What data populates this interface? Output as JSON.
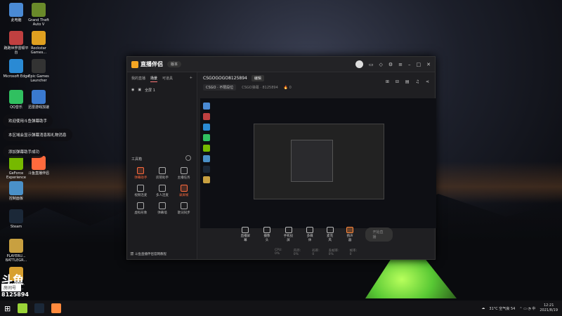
{
  "desktop": {
    "icons": [
      {
        "label": "此电脑",
        "color": "#4a8ad4"
      },
      {
        "label": "Grand Theft Auto V",
        "color": "#6a8a2a"
      },
      {
        "label": "跑跑世界雷顿平台",
        "color": "#c04040"
      },
      {
        "label": "Rockstar Games...",
        "color": "#e0a020"
      },
      {
        "label": "Microsoft Edge",
        "color": "#2a8ad4"
      },
      {
        "label": "Epic Games Launcher",
        "color": "#333333"
      },
      {
        "label": "QQ音乐",
        "color": "#30c060"
      },
      {
        "label": "迅雷游戏加速",
        "color": "#3a7ad0"
      },
      {
        "label": "GeForce Experience",
        "color": "#76b900"
      },
      {
        "label": "斗鱼直播伴侣",
        "color": "#ff6a3d"
      },
      {
        "label": "控制面板",
        "color": "#4a90c8"
      },
      {
        "label": "Steam",
        "color": "#1b2838"
      },
      {
        "label": "PLAYERU... BATTLEGR...",
        "color": "#c8a040"
      },
      {
        "label": "Counter... Global...",
        "color": "#d8a030"
      }
    ]
  },
  "notifications": [
    "欢迎使用斗鱼弹幕助手",
    "本区域会显示弹幕消息和礼物消息",
    "添加弹幕助手成功"
  ],
  "window": {
    "logo": "直播伴侣",
    "version_btn": "版本",
    "tabs": [
      "我的直播",
      "场景",
      "可道具"
    ],
    "scene_label": "全屏 1",
    "tools_header": "工具箱",
    "tools": [
      {
        "label": "弹幕助手",
        "active": true
      },
      {
        "label": "房管助手",
        "active": false
      },
      {
        "label": "主播任务",
        "active": false
      },
      {
        "label": "视频连麦",
        "active": false
      },
      {
        "label": "多人连麦",
        "active": false
      },
      {
        "label": "录屏帧",
        "active": true
      },
      {
        "label": "虚拟形象",
        "active": false
      },
      {
        "label": "弹幕墙",
        "active": false
      },
      {
        "label": "歌词同步",
        "active": false
      }
    ],
    "bottom_text": "斗鱼直播伴侣官网教程",
    "room_title": "CSGOGOGO8125894",
    "room_tag": "编辑",
    "category": "CSGO · 不限段位",
    "room_sub": "CSGO弹幕 · 8125894",
    "hot": "0",
    "controls": [
      "直播屏幕",
      "摄像头",
      "手机投屏",
      "多媒体",
      "麦克风",
      "扬声器"
    ],
    "start_btn": "开始直播",
    "status": [
      "CPU: 0%",
      "内存: 0%",
      "码率: 0",
      "丢帧率: 0%",
      "帧率: 0"
    ]
  },
  "watermark": {
    "logo": "斗鱼",
    "tag": "房间号",
    "number": "8125894"
  },
  "taskbar": {
    "weather": "31°C 空气良 54",
    "time": "12:21",
    "date": "2021/8/19",
    "apps": [
      {
        "color": "#9ad438"
      },
      {
        "color": "#1b2838"
      },
      {
        "color": "#ff8a3d"
      }
    ]
  }
}
